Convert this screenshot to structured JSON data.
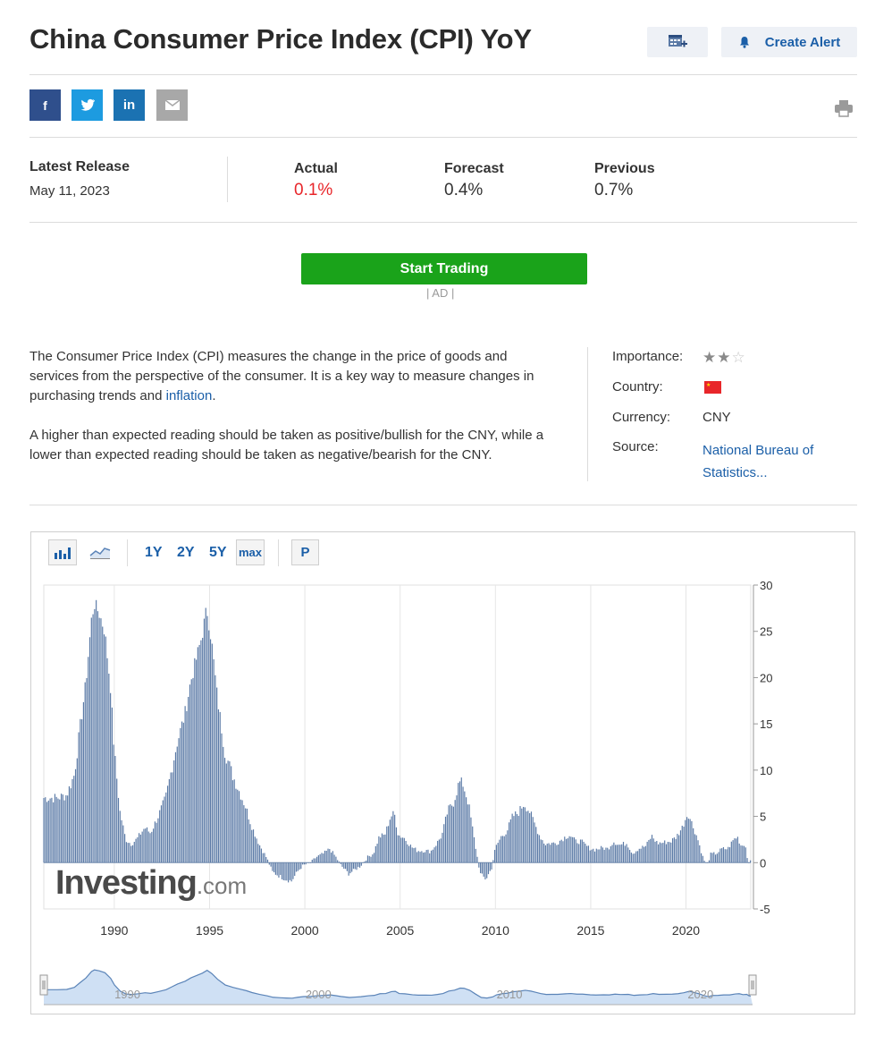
{
  "header": {
    "title": "China Consumer Price Index (CPI) YoY",
    "create_alert_label": "Create Alert"
  },
  "release": {
    "latest_label": "Latest Release",
    "latest_date": "May 11, 2023",
    "actual_label": "Actual",
    "actual_value": "0.1%",
    "forecast_label": "Forecast",
    "forecast_value": "0.4%",
    "previous_label": "Previous",
    "previous_value": "0.7%"
  },
  "ad": {
    "button_label": "Start Trading",
    "ad_label": "| AD |"
  },
  "description": {
    "p1_before": "The Consumer Price Index (CPI) measures the change in the price of goods and services from the perspective of the consumer. It is a key way to measure changes in purchasing trends and ",
    "p1_link": "inflation",
    "p1_after": ".",
    "p2": "A higher than expected reading should be taken as positive/bullish for the CNY, while a lower than expected reading should be taken as negative/bearish for the CNY."
  },
  "info": {
    "importance_label": "Importance:",
    "importance_stars": 2,
    "importance_max": 3,
    "country_label": "Country:",
    "currency_label": "Currency:",
    "currency_value": "CNY",
    "source_label": "Source:",
    "source_line1": "National Bureau of",
    "source_line2": "Statistics..."
  },
  "colors": {
    "actual_red": "#e8262a",
    "link_blue": "#1b5fa8",
    "bar_blue": "#5b7aa6",
    "trade_green": "#1aa31a"
  },
  "toolbar": {
    "range_1y": "1Y",
    "range_2y": "2Y",
    "range_5y": "5Y",
    "range_max": "max",
    "range_p": "P"
  },
  "watermark": {
    "brand": "Investing",
    "suffix": ".com"
  },
  "chart_data": {
    "type": "bar",
    "title": "",
    "xlabel": "",
    "ylabel": "",
    "ylim": [
      -5,
      30
    ],
    "xlim": [
      1986.3,
      2023.4
    ],
    "y_ticks": [
      -5,
      0,
      5,
      10,
      15,
      20,
      25,
      30
    ],
    "x_ticks": [
      1990,
      1995,
      2000,
      2005,
      2010,
      2015,
      2020
    ],
    "navigator_labels": [
      "1990",
      "2000",
      "2010",
      "2020"
    ],
    "series": [
      {
        "points": [
          [
            1986.3,
            7.0
          ],
          [
            1987.0,
            7.0
          ],
          [
            1987.5,
            7.3
          ],
          [
            1987.9,
            9.5
          ],
          [
            1988.2,
            14.5
          ],
          [
            1988.5,
            19.3
          ],
          [
            1988.8,
            26.2
          ],
          [
            1988.95,
            28.0
          ],
          [
            1989.2,
            27.0
          ],
          [
            1989.5,
            25.0
          ],
          [
            1989.8,
            19.0
          ],
          [
            1990.0,
            12.0
          ],
          [
            1990.3,
            5.5
          ],
          [
            1990.6,
            2.5
          ],
          [
            1990.9,
            2.0
          ],
          [
            1991.2,
            2.6
          ],
          [
            1991.6,
            3.8
          ],
          [
            1991.9,
            3.2
          ],
          [
            1992.3,
            5.0
          ],
          [
            1992.7,
            7.0
          ],
          [
            1993.0,
            10.0
          ],
          [
            1993.3,
            13.0
          ],
          [
            1993.7,
            16.0
          ],
          [
            1994.0,
            19.5
          ],
          [
            1994.3,
            22.0
          ],
          [
            1994.6,
            24.5
          ],
          [
            1994.85,
            27.5
          ],
          [
            1995.1,
            24.0
          ],
          [
            1995.4,
            18.0
          ],
          [
            1995.8,
            12.0
          ],
          [
            1996.2,
            9.5
          ],
          [
            1996.6,
            7.5
          ],
          [
            1996.9,
            6.0
          ],
          [
            1997.2,
            4.0
          ],
          [
            1997.6,
            2.0
          ],
          [
            1998.0,
            0.5
          ],
          [
            1998.3,
            -1.0
          ],
          [
            1998.7,
            -1.5
          ],
          [
            1999.0,
            -1.8
          ],
          [
            1999.3,
            -2.0
          ],
          [
            1999.6,
            -1.0
          ],
          [
            1999.9,
            -0.3
          ],
          [
            2000.3,
            0.0
          ],
          [
            2000.6,
            0.6
          ],
          [
            2001.0,
            1.0
          ],
          [
            2001.3,
            1.5
          ],
          [
            2001.6,
            0.7
          ],
          [
            2001.9,
            -0.3
          ],
          [
            2002.3,
            -1.2
          ],
          [
            2002.6,
            -0.8
          ],
          [
            2002.9,
            -0.4
          ],
          [
            2003.3,
            0.6
          ],
          [
            2003.6,
            1.0
          ],
          [
            2003.9,
            2.8
          ],
          [
            2004.2,
            3.0
          ],
          [
            2004.5,
            5.0
          ],
          [
            2004.7,
            5.3
          ],
          [
            2004.9,
            3.0
          ],
          [
            2005.2,
            2.7
          ],
          [
            2005.6,
            1.7
          ],
          [
            2005.9,
            1.3
          ],
          [
            2006.3,
            1.3
          ],
          [
            2006.6,
            1.2
          ],
          [
            2006.9,
            2.0
          ],
          [
            2007.2,
            3.0
          ],
          [
            2007.5,
            5.6
          ],
          [
            2007.8,
            6.5
          ],
          [
            2008.1,
            8.7
          ],
          [
            2008.3,
            8.5
          ],
          [
            2008.6,
            6.3
          ],
          [
            2008.9,
            2.4
          ],
          [
            2009.2,
            -1.2
          ],
          [
            2009.5,
            -1.8
          ],
          [
            2009.8,
            -0.6
          ],
          [
            2010.0,
            1.6
          ],
          [
            2010.3,
            2.8
          ],
          [
            2010.6,
            3.4
          ],
          [
            2010.9,
            5.0
          ],
          [
            2011.2,
            5.4
          ],
          [
            2011.5,
            6.4
          ],
          [
            2011.8,
            5.5
          ],
          [
            2012.0,
            4.5
          ],
          [
            2012.3,
            3.0
          ],
          [
            2012.6,
            2.0
          ],
          [
            2012.9,
            2.1
          ],
          [
            2013.2,
            2.1
          ],
          [
            2013.6,
            2.7
          ],
          [
            2013.9,
            3.0
          ],
          [
            2014.2,
            2.3
          ],
          [
            2014.5,
            2.3
          ],
          [
            2014.9,
            1.6
          ],
          [
            2015.2,
            1.4
          ],
          [
            2015.6,
            1.6
          ],
          [
            2015.9,
            1.5
          ],
          [
            2016.2,
            2.3
          ],
          [
            2016.5,
            1.9
          ],
          [
            2016.9,
            2.1
          ],
          [
            2017.2,
            1.0
          ],
          [
            2017.5,
            1.5
          ],
          [
            2017.9,
            1.8
          ],
          [
            2018.2,
            2.9
          ],
          [
            2018.5,
            2.1
          ],
          [
            2018.9,
            2.2
          ],
          [
            2019.2,
            2.3
          ],
          [
            2019.5,
            2.8
          ],
          [
            2019.8,
            3.8
          ],
          [
            2020.1,
            5.4
          ],
          [
            2020.3,
            4.3
          ],
          [
            2020.6,
            2.7
          ],
          [
            2020.9,
            0.5
          ],
          [
            2021.1,
            -0.3
          ],
          [
            2021.3,
            0.9
          ],
          [
            2021.6,
            1.0
          ],
          [
            2021.9,
            1.5
          ],
          [
            2022.2,
            1.5
          ],
          [
            2022.5,
            2.5
          ],
          [
            2022.7,
            2.8
          ],
          [
            2022.9,
            1.8
          ],
          [
            2023.1,
            2.1
          ],
          [
            2023.2,
            0.7
          ],
          [
            2023.3,
            0.1
          ]
        ]
      }
    ],
    "grid": true,
    "y_axis_position": "right"
  }
}
